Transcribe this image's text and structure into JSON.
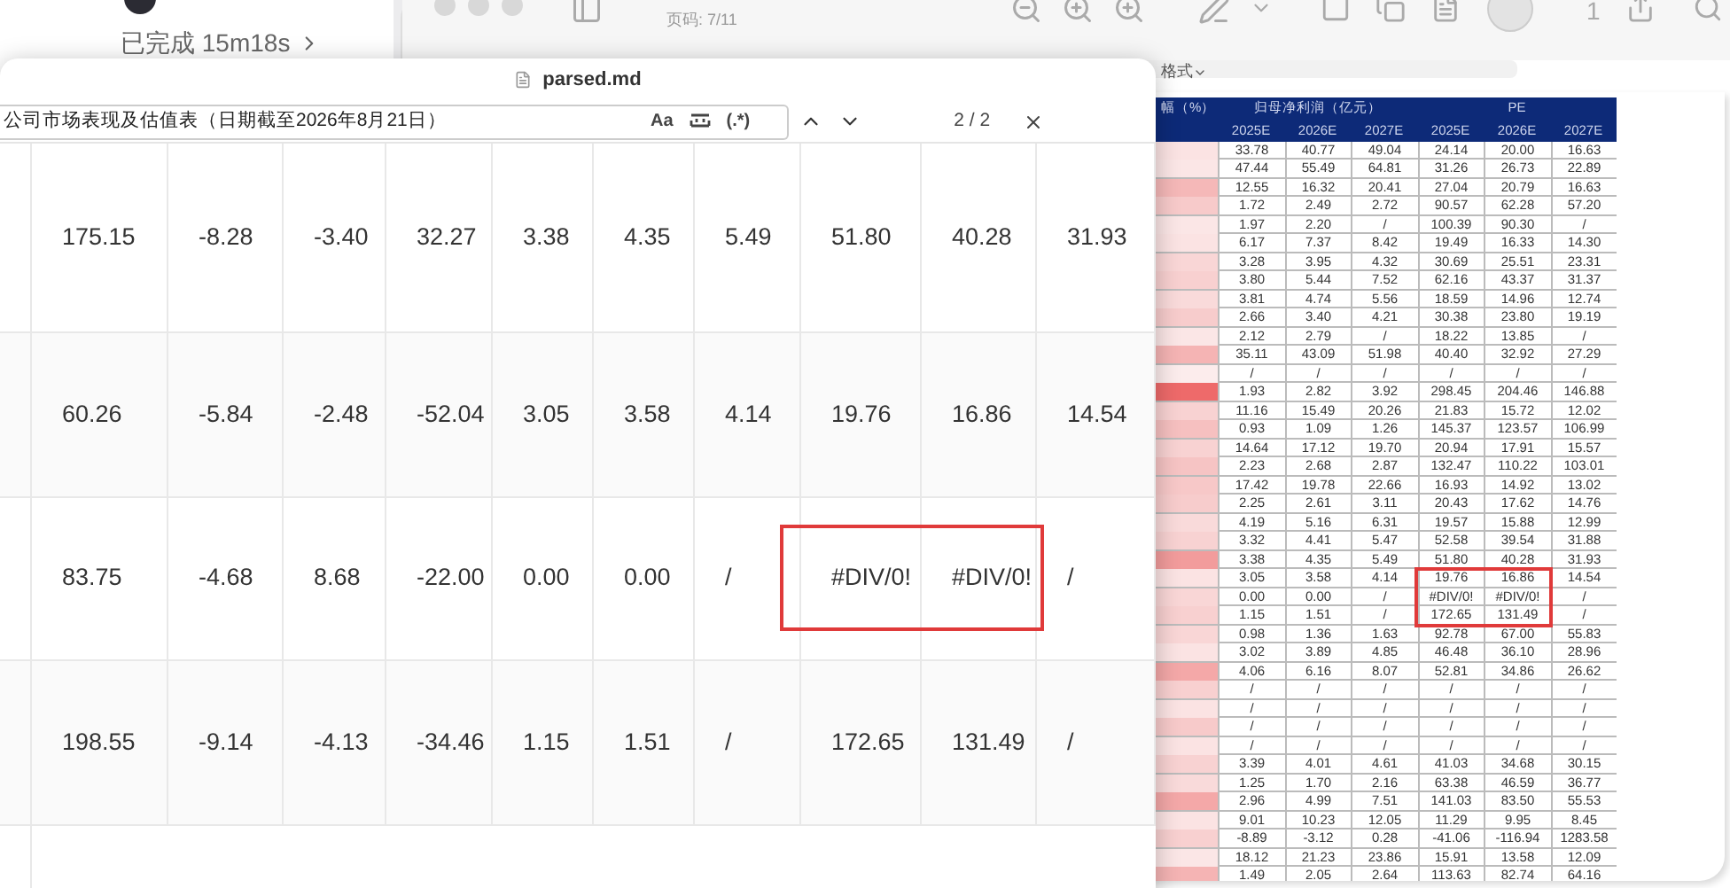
{
  "sidebar_panel": {
    "status": "已完成 15m18s"
  },
  "pdf_viewer": {
    "page_indicator": "页码: 7/11",
    "toolbar_count": "1",
    "format_menu": "格式",
    "table": {
      "group_headers": [
        "幅（%）",
        "归母净利润（亿元）",
        "PE"
      ],
      "years": [
        "2025E",
        "2026E",
        "2027E",
        "2025E",
        "2026E",
        "2027E"
      ],
      "rows": [
        {
          "color": "#fbe3e3",
          "values": [
            "33.78",
            "40.77",
            "49.04",
            "24.14",
            "20.00",
            "16.63"
          ]
        },
        {
          "color": "#fbe6e6",
          "values": [
            "47.44",
            "55.49",
            "64.81",
            "31.26",
            "26.73",
            "22.89"
          ]
        },
        {
          "color": "#f5b8b8",
          "values": [
            "12.55",
            "16.32",
            "20.41",
            "27.04",
            "20.79",
            "16.63"
          ]
        },
        {
          "color": "#f7caca",
          "values": [
            "1.72",
            "2.49",
            "2.72",
            "90.57",
            "62.28",
            "57.20"
          ]
        },
        {
          "color": "#fbe6e6",
          "values": [
            "1.97",
            "2.20",
            "/",
            "100.39",
            "90.30",
            "/"
          ]
        },
        {
          "color": "#fbe3e3",
          "values": [
            "6.17",
            "7.37",
            "8.42",
            "19.49",
            "16.33",
            "14.30"
          ]
        },
        {
          "color": "#f9d6d6",
          "values": [
            "3.28",
            "3.95",
            "4.32",
            "30.69",
            "25.51",
            "23.31"
          ]
        },
        {
          "color": "#f8d0d0",
          "values": [
            "3.80",
            "5.44",
            "7.52",
            "62.16",
            "43.37",
            "31.37"
          ]
        },
        {
          "color": "#f9dada",
          "values": [
            "3.81",
            "4.74",
            "5.56",
            "18.59",
            "14.96",
            "12.74"
          ]
        },
        {
          "color": "#f7cccc",
          "values": [
            "2.66",
            "3.40",
            "4.21",
            "30.38",
            "23.80",
            "19.19"
          ]
        },
        {
          "color": "#fbe6e6",
          "values": [
            "2.12",
            "2.79",
            "/",
            "18.22",
            "13.85",
            "/"
          ]
        },
        {
          "color": "#f5b4b4",
          "values": [
            "35.11",
            "43.09",
            "51.98",
            "40.40",
            "32.92",
            "27.29"
          ]
        },
        {
          "color": "#fcecec",
          "values": [
            "/",
            "/",
            "/",
            "/",
            "/",
            "/"
          ]
        },
        {
          "color": "#ee6a6a",
          "values": [
            "1.93",
            "2.82",
            "3.92",
            "298.45",
            "204.46",
            "146.88"
          ]
        },
        {
          "color": "#f8d2d2",
          "values": [
            "11.16",
            "15.49",
            "20.26",
            "21.83",
            "15.72",
            "12.02"
          ]
        },
        {
          "color": "#f6c0c0",
          "values": [
            "0.93",
            "1.09",
            "1.26",
            "145.37",
            "123.57",
            "106.99"
          ]
        },
        {
          "color": "#f8d2d2",
          "values": [
            "14.64",
            "17.12",
            "19.70",
            "20.94",
            "17.91",
            "15.57"
          ]
        },
        {
          "color": "#f6c4c4",
          "values": [
            "2.23",
            "2.68",
            "2.87",
            "132.47",
            "110.22",
            "103.01"
          ]
        },
        {
          "color": "#f7c8c8",
          "values": [
            "17.42",
            "19.78",
            "22.66",
            "16.93",
            "14.92",
            "13.02"
          ]
        },
        {
          "color": "#f7cccc",
          "values": [
            "2.25",
            "2.61",
            "3.11",
            "20.43",
            "17.62",
            "14.76"
          ]
        },
        {
          "color": "#f9dada",
          "values": [
            "4.19",
            "5.16",
            "6.31",
            "19.57",
            "15.88",
            "12.99"
          ]
        },
        {
          "color": "#f8d2d2",
          "values": [
            "3.32",
            "4.41",
            "5.47",
            "52.58",
            "39.54",
            "31.88"
          ]
        },
        {
          "color": "#f29c9c",
          "values": [
            "3.38",
            "4.35",
            "5.49",
            "51.80",
            "40.28",
            "31.93"
          ]
        },
        {
          "color": "#fbe3e3",
          "values": [
            "3.05",
            "3.58",
            "4.14",
            "19.76",
            "16.86",
            "14.54"
          ]
        },
        {
          "color": "#f9d6d6",
          "values": [
            "0.00",
            "0.00",
            "/",
            "#DIV/0!",
            "#DIV/0!",
            "/"
          ]
        },
        {
          "color": "#f8d0d0",
          "values": [
            "1.15",
            "1.51",
            "/",
            "172.65",
            "131.49",
            "/"
          ]
        },
        {
          "color": "#f9d6d6",
          "values": [
            "0.98",
            "1.36",
            "1.63",
            "92.78",
            "67.00",
            "55.83"
          ]
        },
        {
          "color": "#fbe3e3",
          "values": [
            "3.02",
            "3.89",
            "4.85",
            "46.48",
            "36.10",
            "28.96"
          ]
        },
        {
          "color": "#f4a8a8",
          "values": [
            "4.06",
            "6.16",
            "8.07",
            "52.81",
            "34.86",
            "26.62"
          ]
        },
        {
          "color": "#f8d0d0",
          "values": [
            "/",
            "/",
            "/",
            "/",
            "/",
            "/"
          ]
        },
        {
          "color": "#fbe3e3",
          "values": [
            "/",
            "/",
            "/",
            "/",
            "/",
            "/"
          ]
        },
        {
          "color": "#f7caca",
          "values": [
            "/",
            "/",
            "/",
            "/",
            "/",
            "/"
          ]
        },
        {
          "color": "#fbe3e3",
          "values": [
            "/",
            "/",
            "/",
            "/",
            "/",
            "/"
          ]
        },
        {
          "color": "#f8d2d2",
          "values": [
            "3.39",
            "4.01",
            "4.61",
            "41.03",
            "34.68",
            "30.15"
          ]
        },
        {
          "color": "#f9dada",
          "values": [
            "1.25",
            "1.70",
            "2.16",
            "63.38",
            "46.59",
            "36.77"
          ]
        },
        {
          "color": "#f4a8a8",
          "values": [
            "2.96",
            "4.99",
            "7.51",
            "141.03",
            "83.50",
            "55.53"
          ]
        },
        {
          "color": "#fbe3e3",
          "values": [
            "9.01",
            "10.23",
            "12.05",
            "11.29",
            "9.95",
            "8.45"
          ]
        },
        {
          "color": "#f8d0d0",
          "values": [
            "-8.89",
            "-3.12",
            "0.28",
            "-41.06",
            "-116.94",
            "1283.58"
          ]
        },
        {
          "color": "#fbe6e6",
          "values": [
            "18.12",
            "21.23",
            "23.86",
            "15.91",
            "13.58",
            "12.09"
          ]
        },
        {
          "color": "#f5b4b4",
          "values": [
            "1.49",
            "2.05",
            "2.64",
            "113.63",
            "82.74",
            "64.16"
          ]
        }
      ]
    }
  },
  "markdown_window": {
    "title": "parsed.md",
    "find": {
      "query": "公司市场表现及估值表（日期截至2026年8月21日）",
      "match_case": "Aa",
      "regex": "(.*)",
      "count": "2 / 2"
    },
    "rows": [
      {
        "values": [
          "175.15",
          "-8.28",
          "-3.40",
          "32.27",
          "3.38",
          "4.35",
          "5.49",
          "51.80",
          "40.28",
          "31.93"
        ]
      },
      {
        "values": [
          "60.26",
          "-5.84",
          "-2.48",
          "-52.04",
          "3.05",
          "3.58",
          "4.14",
          "19.76",
          "16.86",
          "14.54"
        ]
      },
      {
        "values": [
          "83.75",
          "-4.68",
          "8.68",
          "-22.00",
          "0.00",
          "0.00",
          "/",
          "#DIV/0!",
          "#DIV/0!",
          "/"
        ]
      },
      {
        "values": [
          "198.55",
          "-9.14",
          "-4.13",
          "-34.46",
          "1.15",
          "1.51",
          "/",
          "172.65",
          "131.49",
          "/"
        ]
      }
    ]
  }
}
